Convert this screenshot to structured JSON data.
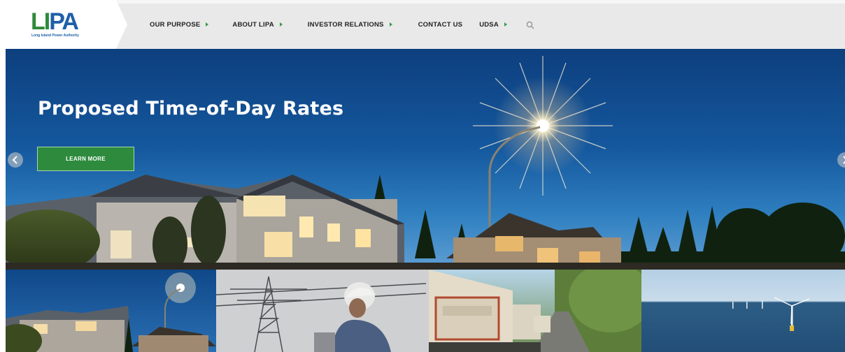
{
  "header": {
    "logo_text_a": "L",
    "logo_text_b": "I",
    "logo_text_c": "PA",
    "logo_subtitle": "Long Island Power Authority",
    "nav": [
      {
        "label": "OUR PURPOSE",
        "has_submenu": true
      },
      {
        "label": "ABOUT LIPA",
        "has_submenu": true
      },
      {
        "label": "INVESTOR RELATIONS",
        "has_submenu": true
      },
      {
        "label": "CONTACT US",
        "has_submenu": false
      },
      {
        "label": "UDSA",
        "has_submenu": true
      }
    ],
    "search_icon": "search-icon"
  },
  "hero": {
    "title": "Proposed Time-of-Day Rates",
    "button_label": "LEARN MORE"
  },
  "tiles": [
    {
      "name": "houses-at-dusk"
    },
    {
      "name": "lineworker-transmission-tower"
    },
    {
      "name": "utility-trucks-road"
    },
    {
      "name": "offshore-wind-turbines"
    }
  ],
  "colors": {
    "accent_green": "#2e8b3e",
    "brand_blue": "#1f5fa8",
    "nav_bg": "#e9e9e9"
  }
}
